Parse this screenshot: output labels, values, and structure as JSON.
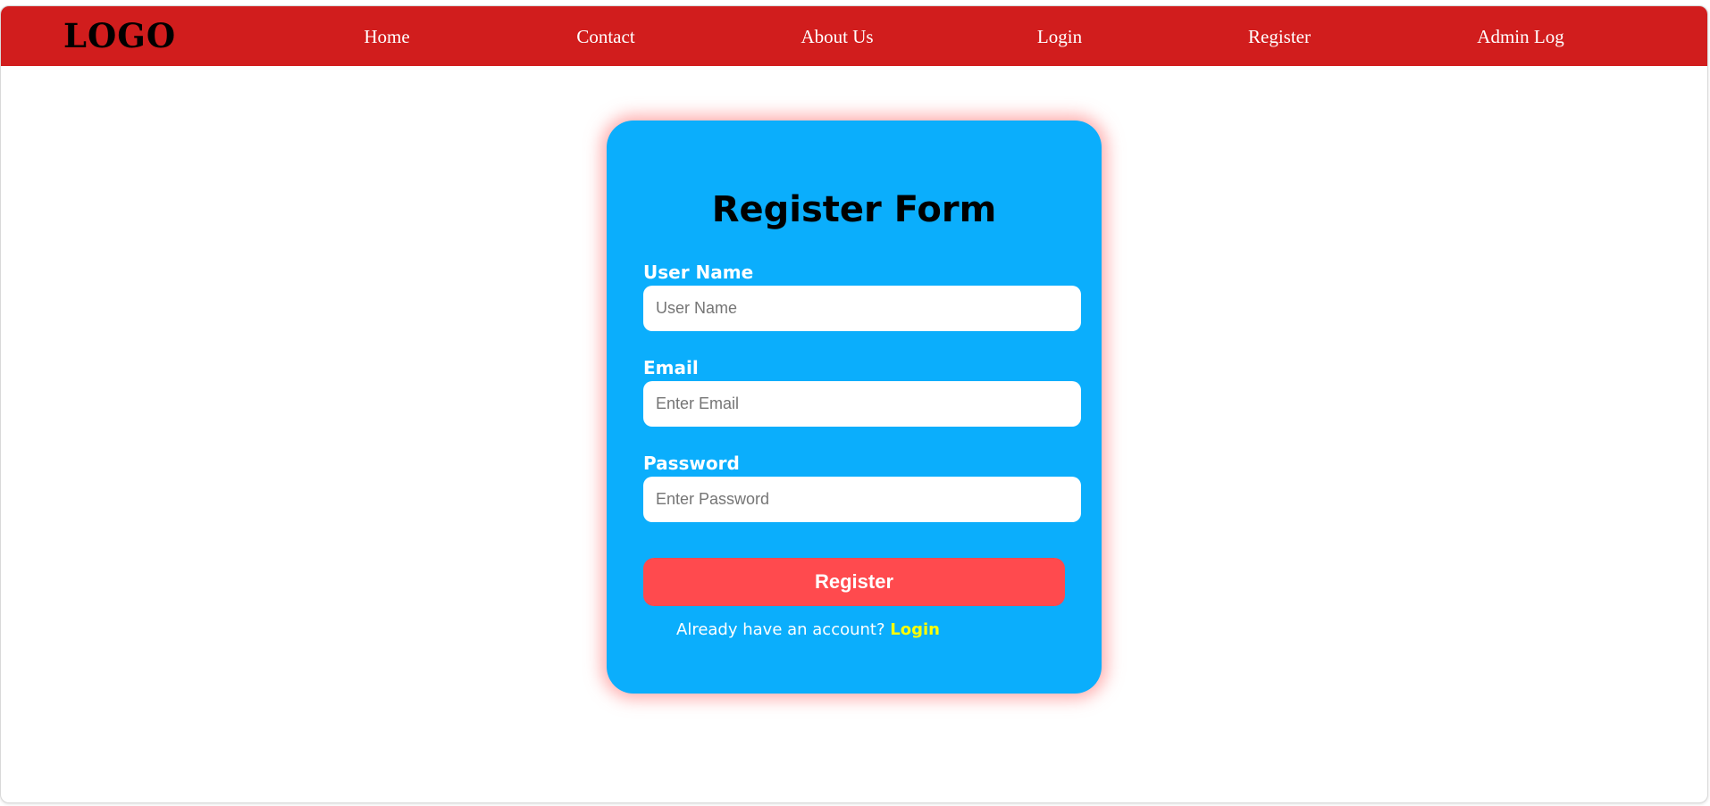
{
  "navbar": {
    "logo": "LOGO",
    "links": [
      {
        "label": "Home"
      },
      {
        "label": "Contact"
      },
      {
        "label": "About Us"
      },
      {
        "label": "Login"
      },
      {
        "label": "Register"
      },
      {
        "label": "Admin Log"
      }
    ],
    "background_color": "#d11d1d"
  },
  "form": {
    "title": "Register Form",
    "background_color": "#0baefc",
    "fields": [
      {
        "label": "User Name",
        "placeholder": "User Name",
        "value": ""
      },
      {
        "label": "Email",
        "placeholder": "Enter Email",
        "value": ""
      },
      {
        "label": "Password",
        "placeholder": "Enter Password",
        "value": ""
      }
    ],
    "submit_label": "Register",
    "submit_color": "#ff4a4e",
    "account_prompt": "Already have an account?",
    "login_link_label": "Login",
    "login_link_color": "#ffff00"
  }
}
